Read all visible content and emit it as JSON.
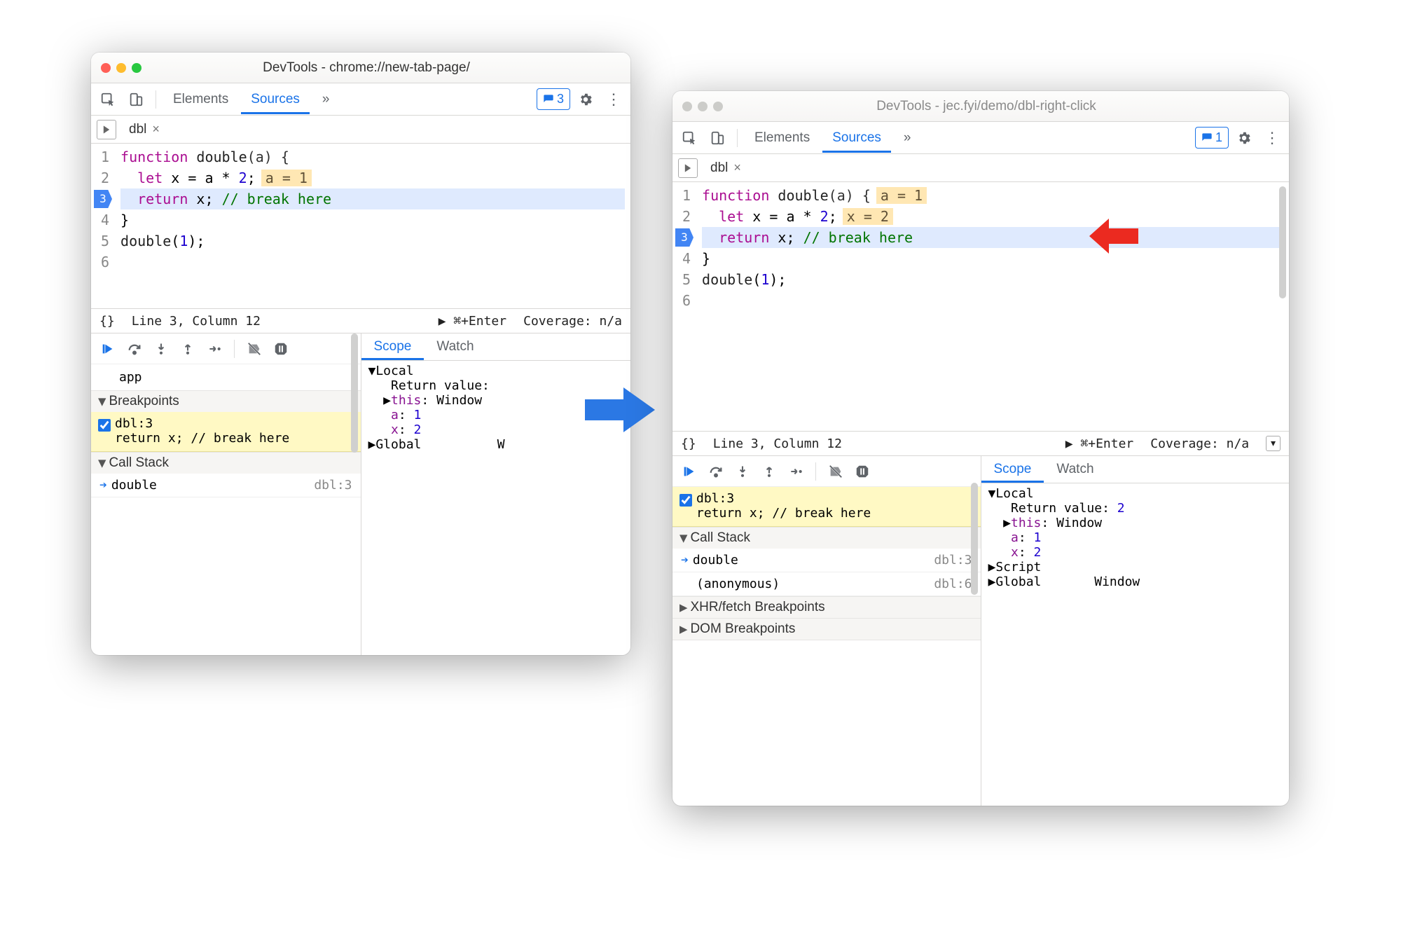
{
  "left_window": {
    "title": "DevTools - chrome://new-tab-page/",
    "tabs": {
      "elements": "Elements",
      "sources": "Sources",
      "more": "»"
    },
    "issues_count": "3",
    "file_tab": "dbl",
    "gutter": [
      "1",
      "2",
      "3",
      "4",
      "5",
      "6"
    ],
    "code": {
      "l1_kw1": "function",
      "l1_fn": " double",
      "l1_rest": "(a) {",
      "l2_indent": "  ",
      "l2_kw": "let",
      "l2_rest": " x = a * ",
      "l2_num": "2",
      "l2_semi": ";",
      "l2_annot": "a = 1",
      "l3_indent": "  ",
      "l3_kw": "return",
      "l3_rest": " x; ",
      "l3_cmt": "// break here",
      "l4": "}",
      "l5": "",
      "l6_fn": "double",
      "l6_p": "(",
      "l6_num": "1",
      "l6_end": ");"
    },
    "bp_line": "3",
    "status": {
      "braces": "{}",
      "pos": "Line 3, Column 12",
      "run": "▶ ⌘+Enter",
      "cov": "Coverage: n/a"
    },
    "scope_tabs": {
      "scope": "Scope",
      "watch": "Watch"
    },
    "sidebar_items": {
      "item0": "app"
    },
    "breakpoints_label": "Breakpoints",
    "bp0_name": "dbl:3",
    "bp0_snippet": "return x; // break here",
    "callstack_label": "Call Stack",
    "stack0_fn": "double",
    "stack0_loc": "dbl:3",
    "scope": {
      "local": "Local",
      "return_label": "Return value:",
      "this_label": "this",
      "this_val": "Window",
      "a_label": "a",
      "a_val": "1",
      "x_label": "x",
      "x_val": "2",
      "global": "Global",
      "global_val": "W"
    }
  },
  "right_window": {
    "title": "DevTools - jec.fyi/demo/dbl-right-click",
    "tabs": {
      "elements": "Elements",
      "sources": "Sources",
      "more": "»"
    },
    "issues_count": "1",
    "file_tab": "dbl",
    "gutter": [
      "1",
      "2",
      "3",
      "4",
      "5",
      "6"
    ],
    "code": {
      "l1_kw1": "function",
      "l1_fn": " double",
      "l1_rest": "(a) {",
      "l1_annot": "a = 1",
      "l2_indent": "  ",
      "l2_kw": "let",
      "l2_rest": " x = a * ",
      "l2_num": "2",
      "l2_semi": ";",
      "l2_annot": "x = 2",
      "l3_indent": "  ",
      "l3_kw": "return",
      "l3_rest": " x; ",
      "l3_cmt": "// break here",
      "l4": "}",
      "l5": "",
      "l6_fn": "double",
      "l6_p": "(",
      "l6_num": "1",
      "l6_end": ");"
    },
    "bp_line": "3",
    "status": {
      "braces": "{}",
      "pos": "Line 3, Column 12",
      "run": "▶ ⌘+Enter",
      "cov": "Coverage: n/a"
    },
    "scope_tabs": {
      "scope": "Scope",
      "watch": "Watch"
    },
    "bp0_name": "dbl:3",
    "bp0_snippet": "return x; // break here",
    "callstack_label": "Call Stack",
    "stack0_fn": "double",
    "stack0_loc": "dbl:3",
    "stack1_fn": "(anonymous)",
    "stack1_loc": "dbl:6",
    "xhr_label": "XHR/fetch Breakpoints",
    "dom_label": "DOM Breakpoints",
    "scope": {
      "local": "Local",
      "return_label": "Return value",
      "return_val": "2",
      "this_label": "this",
      "this_val": "Window",
      "a_label": "a",
      "a_val": "1",
      "x_label": "x",
      "x_val": "2",
      "script": "Script",
      "global": "Global",
      "global_val": "Window"
    }
  }
}
